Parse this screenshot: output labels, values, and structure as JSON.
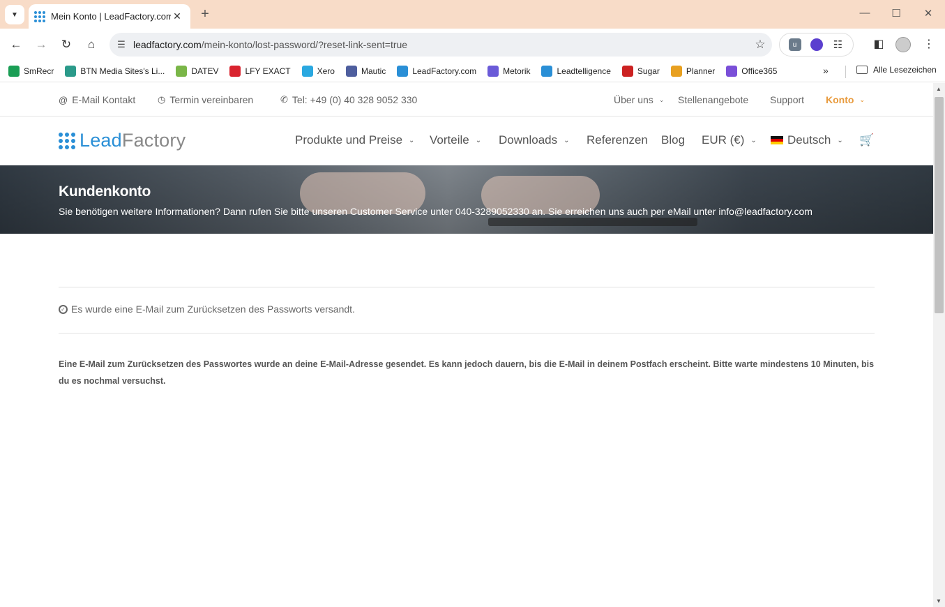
{
  "browser": {
    "tab_title": "Mein Konto | LeadFactory.com",
    "url_host": "leadfactory.com",
    "url_path": "/mein-konto/lost-password/?reset-link-sent=true",
    "bookmarks": [
      {
        "label": "SmRecr",
        "color": "#1a9e55"
      },
      {
        "label": "BTN Media Sites's Li...",
        "color": "#2b9a8a"
      },
      {
        "label": "DATEV",
        "color": "#7ab648"
      },
      {
        "label": "LFY EXACT",
        "color": "#d9232e"
      },
      {
        "label": "Xero",
        "color": "#2aa8e0"
      },
      {
        "label": "Mautic",
        "color": "#4e5e9e"
      },
      {
        "label": "LeadFactory.com",
        "color": "#2a8fd6"
      },
      {
        "label": "Metorik",
        "color": "#6a5ad8"
      },
      {
        "label": "Leadtelligence",
        "color": "#2a8fd6"
      },
      {
        "label": "Sugar",
        "color": "#c22"
      },
      {
        "label": "Planner",
        "color": "#e8a020"
      },
      {
        "label": "Office365",
        "color": "#7a4fd8"
      }
    ],
    "all_bookmarks": "Alle Lesezeichen"
  },
  "topbar": {
    "email": "E-Mail Kontakt",
    "termin": "Termin vereinbaren",
    "phone": "Tel: +49 (0) 40 328 9052 330",
    "ueber_uns": "Über uns",
    "stellen": "Stellenangebote",
    "support": "Support",
    "konto": "Konto"
  },
  "logo": {
    "part1": "Lead",
    "part2": "Factory"
  },
  "mainnav": {
    "produkte": "Produkte und Preise",
    "vorteile": "Vorteile",
    "downloads": "Downloads",
    "referenzen": "Referenzen",
    "blog": "Blog",
    "currency": "EUR (€)",
    "language": "Deutsch"
  },
  "banner": {
    "title": "Kundenkonto",
    "text": "Sie benötigen weitere Informationen? Dann rufen Sie bitte unseren Customer Service unter 040-3289052330 an. Sie erreichen uns auch per eMail unter info@leadfactory.com"
  },
  "notice": "Es wurde eine E-Mail zum Zurücksetzen des Passworts versandt.",
  "body_text": "Eine E-Mail zum Zurücksetzen des Passwortes wurde an deine E-Mail-Adresse gesendet. Es kann jedoch dauern, bis die E-Mail in deinem Postfach erscheint. Bitte warte mindestens 10 Minuten, bis du es nochmal versuchst.",
  "colors": {
    "accent": "#e89a3c",
    "brand": "#2a8fd6"
  }
}
